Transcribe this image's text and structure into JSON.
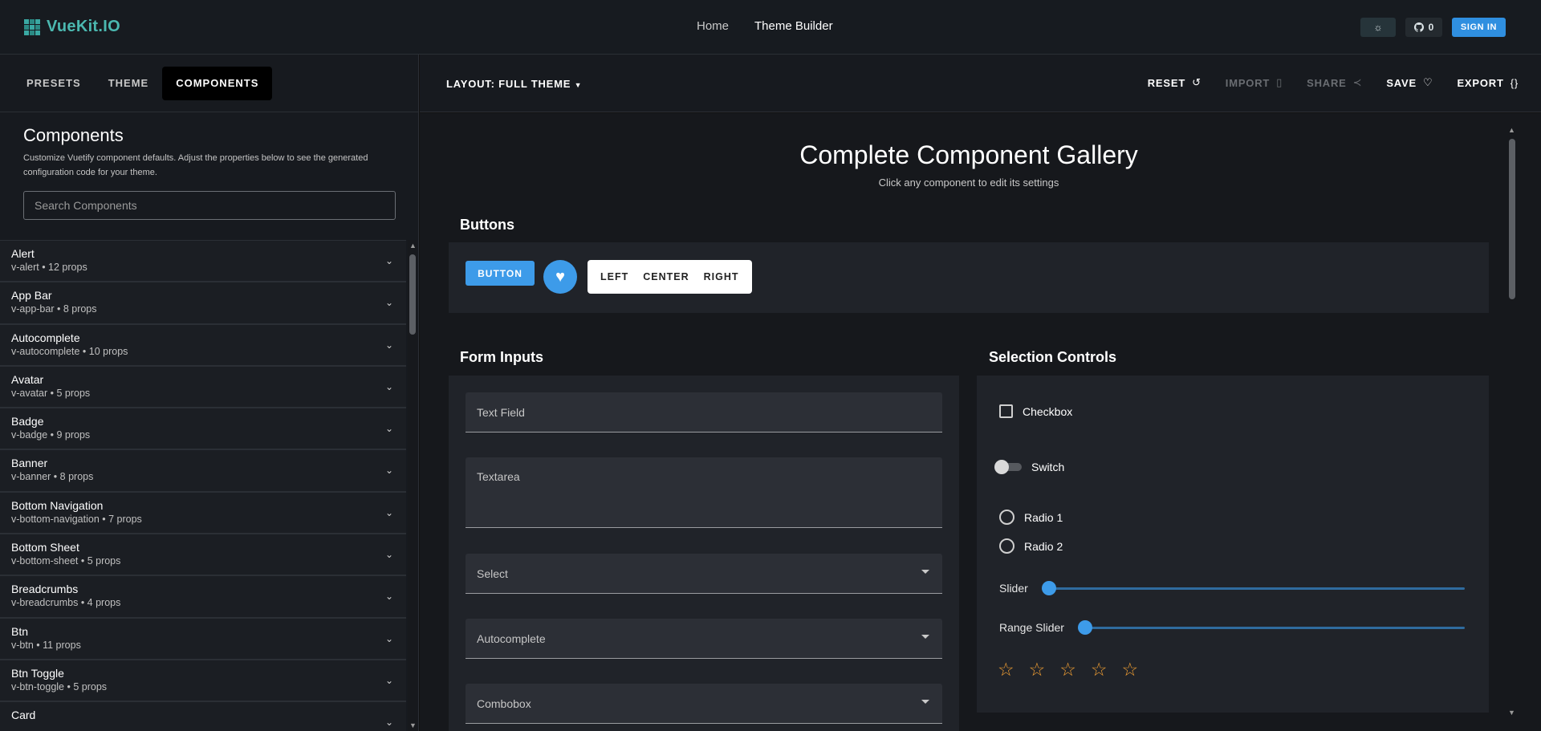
{
  "app": {
    "logo_text": "VueKit.IO",
    "nav": [
      {
        "label": "Home"
      },
      {
        "label": "Theme Builder"
      }
    ],
    "github_count": "0",
    "signin_label": "SIGN IN"
  },
  "left": {
    "tabs": [
      {
        "label": "PRESETS"
      },
      {
        "label": "THEME"
      },
      {
        "label": "COMPONENTS"
      }
    ],
    "title": "Components",
    "description": "Customize Vuetify component defaults. Adjust the properties below to see the generated configuration code for your theme.",
    "search_placeholder": "Search Components",
    "items": [
      {
        "name": "Alert",
        "sub": "v-alert • 12 props"
      },
      {
        "name": "App Bar",
        "sub": "v-app-bar • 8 props"
      },
      {
        "name": "Autocomplete",
        "sub": "v-autocomplete • 10 props"
      },
      {
        "name": "Avatar",
        "sub": "v-avatar • 5 props"
      },
      {
        "name": "Badge",
        "sub": "v-badge • 9 props"
      },
      {
        "name": "Banner",
        "sub": "v-banner • 8 props"
      },
      {
        "name": "Bottom Navigation",
        "sub": "v-bottom-navigation • 7 props"
      },
      {
        "name": "Bottom Sheet",
        "sub": "v-bottom-sheet • 5 props"
      },
      {
        "name": "Breadcrumbs",
        "sub": "v-breadcrumbs • 4 props"
      },
      {
        "name": "Btn",
        "sub": "v-btn • 11 props"
      },
      {
        "name": "Btn Toggle",
        "sub": "v-btn-toggle • 5 props"
      },
      {
        "name": "Card",
        "sub": ""
      }
    ]
  },
  "toolbar": {
    "layout_label": "LAYOUT: FULL THEME",
    "reset": "RESET",
    "import": "IMPORT",
    "share": "SHARE",
    "save": "SAVE",
    "export": "EXPORT"
  },
  "gallery": {
    "title": "Complete Component Gallery",
    "subtitle": "Click any component to edit its settings",
    "buttons_label": "Buttons",
    "button_label": "BUTTON",
    "group": [
      {
        "label": "LEFT"
      },
      {
        "label": "CENTER"
      },
      {
        "label": "RIGHT"
      }
    ],
    "form_label": "Form Inputs",
    "text_field": "Text Field",
    "textarea": "Textarea",
    "select": "Select",
    "autocomplete": "Autocomplete",
    "combobox": "Combobox",
    "selection_label": "Selection Controls",
    "checkbox": "Checkbox",
    "switch": "Switch",
    "radio1": "Radio 1",
    "radio2": "Radio 2",
    "slider": "Slider",
    "range_slider": "Range Slider",
    "rating_stars": 5,
    "rating_value": 0
  },
  "colors": {
    "primary": "#3d9be9",
    "star": "#ee9d33",
    "logo": "#4bb8b0"
  }
}
